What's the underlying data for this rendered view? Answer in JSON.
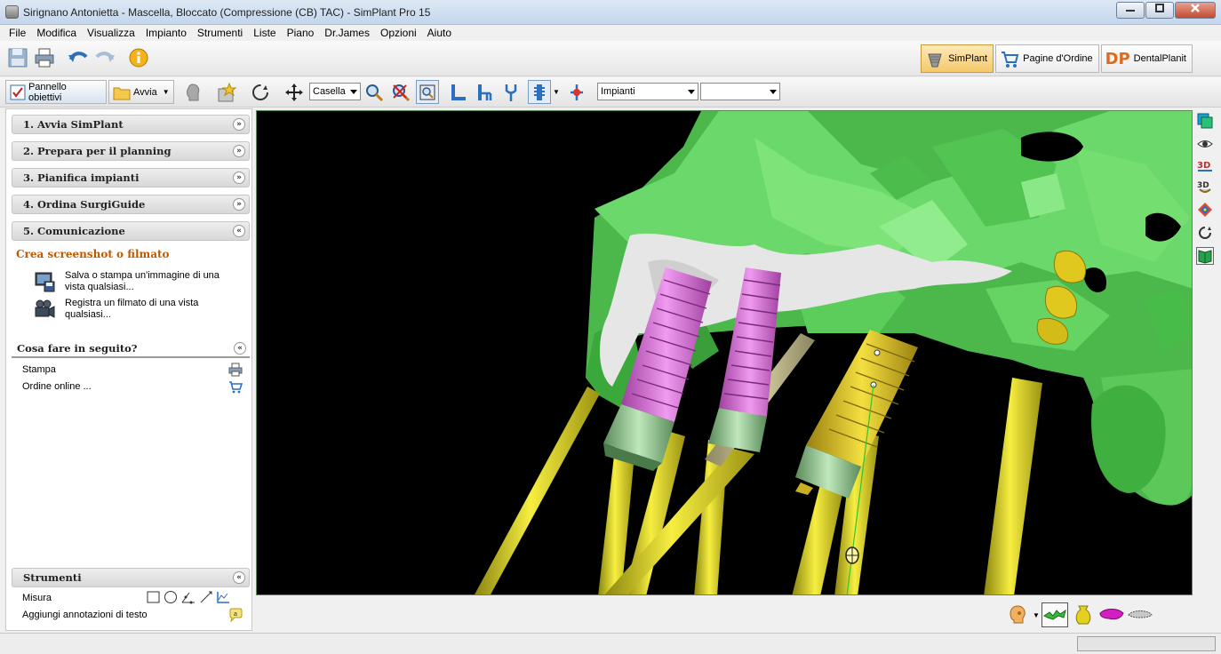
{
  "window": {
    "title": "Sirignano Antonietta - Mascella, Bloccato (Compressione (CB) TAC) - SimPlant Pro 15"
  },
  "menu": [
    "File",
    "Modifica",
    "Visualizza",
    "Impianto",
    "Strumenti",
    "Liste",
    "Piano",
    "Dr.James",
    "Opzioni",
    "Aiuto"
  ],
  "mode_tabs": {
    "simplant": "SimPlant",
    "order_pages": "Pagine d'Ordine",
    "dentalplanit": "DentalPlanit",
    "dp_logo": "DP"
  },
  "toolbar2": {
    "goals_panel": "Pannello obiettivi",
    "start": "Avvia",
    "box_select": "Casella",
    "implants_select": "Impianti",
    "empty_select": ""
  },
  "left_panel": {
    "sections": [
      {
        "label": "1. Avvia SimPlant",
        "chev": "»"
      },
      {
        "label": "2. Prepara per il planning",
        "chev": "»"
      },
      {
        "label": "3. Pianifica impianti",
        "chev": "»"
      },
      {
        "label": "4. Ordina SurgiGuide",
        "chev": "»"
      },
      {
        "label": "5. Comunicazione",
        "chev": "«"
      }
    ],
    "sub_title": "Crea screenshot o filmato",
    "actions": [
      {
        "text": "Salva o stampa un'immagine di una vista qualsiasi..."
      },
      {
        "text": "Registra un filmato di una vista qualsiasi..."
      }
    ],
    "next_header": "Cosa fare in seguito?",
    "next_items": [
      "Stampa",
      "Ordine online ..."
    ],
    "tools_header": "Strumenti",
    "tools_items": [
      "Misura",
      "Aggiungi annotazioni di testo"
    ],
    "chev_up": "«"
  },
  "colors": {
    "bone": "#5fd35f",
    "implant_pink": "#e070e0",
    "implant_gold": "#e0c81e",
    "axis_yellow": "#e8e020",
    "abutment": "#8fd08a"
  }
}
